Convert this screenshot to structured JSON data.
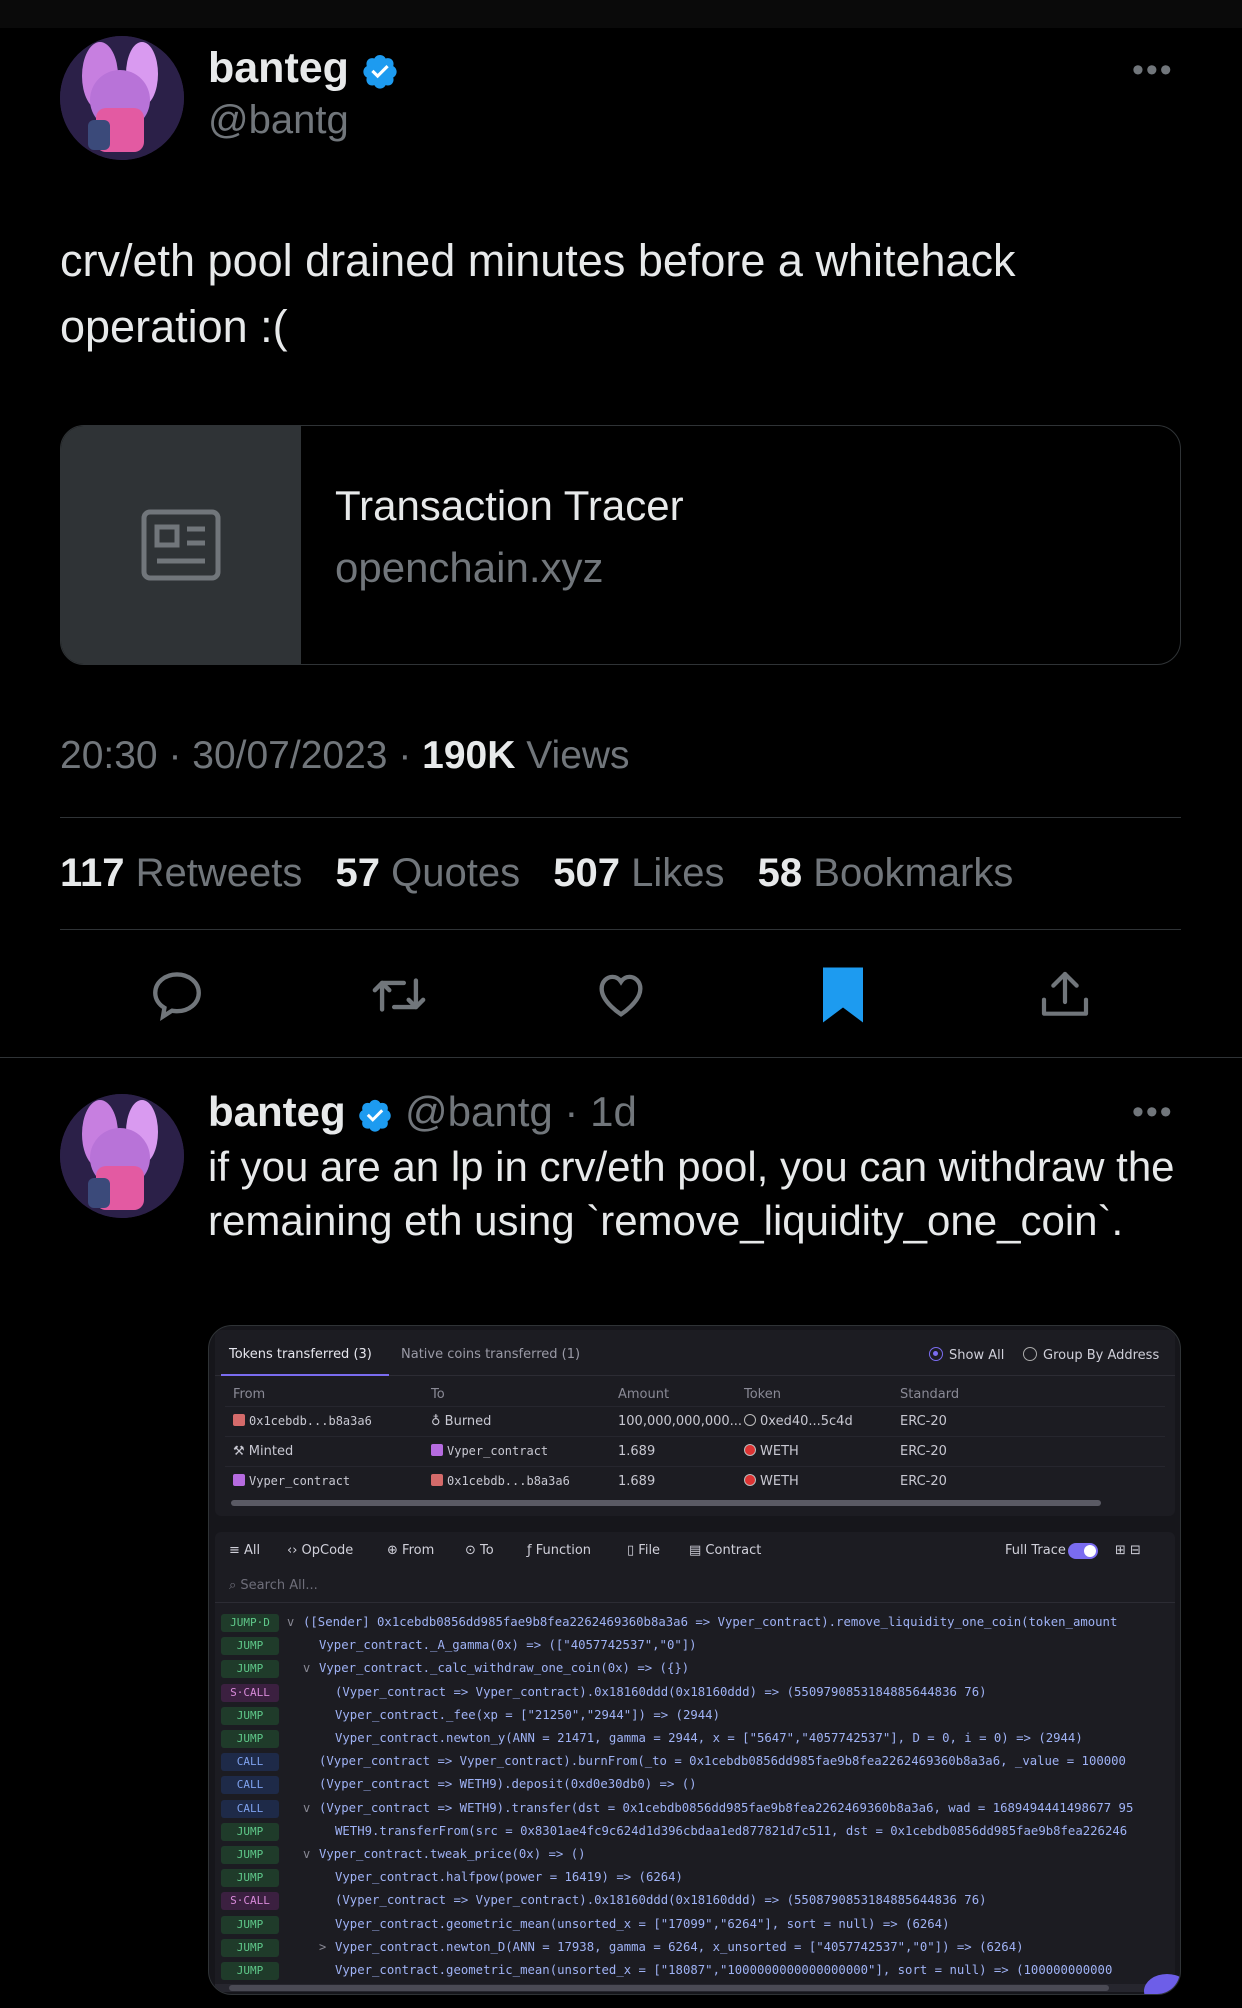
{
  "main_tweet": {
    "author_name": "banteg",
    "author_handle": "@bantg",
    "text": "crv/eth pool drained minutes before a whitehack operation :(",
    "link_card": {
      "title": "Transaction Tracer",
      "domain": "openchain.xyz",
      "thumb_icon": "article-icon"
    },
    "time": "20:30",
    "date": "30/07/2023",
    "views_count": "190K",
    "views_label": "Views",
    "stats": [
      {
        "count": "117",
        "label": "Retweets"
      },
      {
        "count": "57",
        "label": "Quotes"
      },
      {
        "count": "507",
        "label": "Likes"
      },
      {
        "count": "58",
        "label": "Bookmarks"
      }
    ],
    "actions": [
      "reply-icon",
      "retweet-icon",
      "like-icon",
      "bookmark-icon",
      "share-icon"
    ],
    "bookmark_color": "#1d9bf0"
  },
  "reply_tweet": {
    "author_name": "banteg",
    "author_handle": "@bantg",
    "age": "1d",
    "text": "if you are an lp in crv/eth pool, you can withdraw the remaining eth using `remove_liquidity_one_coin`."
  },
  "embedded_screenshot": {
    "tabs": [
      "Tokens transferred (3)",
      "Native coins transferred (1)"
    ],
    "radios": [
      "Show All",
      "Group By Address"
    ],
    "columns": [
      "From",
      "To",
      "Amount",
      "Token",
      "Standard"
    ],
    "rows": [
      [
        "0x1cebdb...b8a3a6",
        "Burned",
        "100,000,000,000...",
        "0xed40...5c4d",
        "ERC-20"
      ],
      [
        "Minted",
        "Vyper_contract",
        "1.689",
        "WETH",
        "ERC-20"
      ],
      [
        "Vyper_contract",
        "0x1cebdb...b8a3a6",
        "1.689",
        "WETH",
        "ERC-20"
      ]
    ],
    "filter_tabs": [
      "All",
      "OpCode",
      "From",
      "To",
      "Function",
      "File",
      "Contract"
    ],
    "full_trace_label": "Full Trace",
    "search_placeholder": "Search All...",
    "trace": [
      {
        "op": "JUMP·D",
        "chev": "v",
        "text": "([Sender] 0x1cebdb0856dd985fae9b8fea2262469360b8a3a6 => Vyper_contract).remove_liquidity_one_coin(token_amount"
      },
      {
        "op": "JUMP",
        "chev": "",
        "text": "Vyper_contract._A_gamma(0x) => ([\"4057742537\",\"0\"])"
      },
      {
        "op": "JUMP",
        "chev": "v",
        "text": "Vyper_contract._calc_withdraw_one_coin(0x) => ({})"
      },
      {
        "op": "S·CALL",
        "chev": "",
        "text": "(Vyper_contract => Vyper_contract).0x18160ddd(0x18160ddd) => (5509790853184885644836 76)"
      },
      {
        "op": "JUMP",
        "chev": "",
        "text": "Vyper_contract._fee(xp = [\"21250\",\"2944\"]) => (2944)"
      },
      {
        "op": "JUMP",
        "chev": "",
        "text": "Vyper_contract.newton_y(ANN = 21471, gamma = 2944, x = [\"5647\",\"4057742537\"], D = 0, i = 0) => (2944)"
      },
      {
        "op": "CALL",
        "chev": "",
        "text": "(Vyper_contract => Vyper_contract).burnFrom(_to = 0x1cebdb0856dd985fae9b8fea2262469360b8a3a6, _value = 100000"
      },
      {
        "op": "CALL",
        "chev": "",
        "text": "(Vyper_contract => WETH9).deposit(0xd0e30db0) => ()"
      },
      {
        "op": "CALL",
        "chev": "v",
        "text": "(Vyper_contract => WETH9).transfer(dst = 0x1cebdb0856dd985fae9b8fea2262469360b8a3a6, wad = 1689494441498677 95"
      },
      {
        "op": "JUMP",
        "chev": "",
        "text": "WETH9.transferFrom(src = 0x8301ae4fc9c624d1d396cbdaa1ed877821d7c511, dst = 0x1cebdb0856dd985fae9b8fea226246"
      },
      {
        "op": "JUMP",
        "chev": "v",
        "text": "Vyper_contract.tweak_price(0x) => ()"
      },
      {
        "op": "JUMP",
        "chev": "",
        "text": "Vyper_contract.halfpow(power = 16419) => (6264)"
      },
      {
        "op": "S·CALL",
        "chev": "",
        "text": "(Vyper_contract => Vyper_contract).0x18160ddd(0x18160ddd) => (5508790853184885644836 76)"
      },
      {
        "op": "JUMP",
        "chev": "",
        "text": "Vyper_contract.geometric_mean(unsorted_x = [\"17099\",\"6264\"], sort = null) => (6264)"
      },
      {
        "op": "JUMP",
        "chev": ">",
        "text": "Vyper_contract.newton_D(ANN = 17938, gamma = 6264, x_unsorted = [\"4057742537\",\"0\"]) => (6264)"
      },
      {
        "op": "JUMP",
        "chev": "",
        "text": "Vyper_contract.geometric_mean(unsorted_x = [\"18087\",\"1000000000000000000\"], sort = null) => (100000000000"
      }
    ]
  }
}
